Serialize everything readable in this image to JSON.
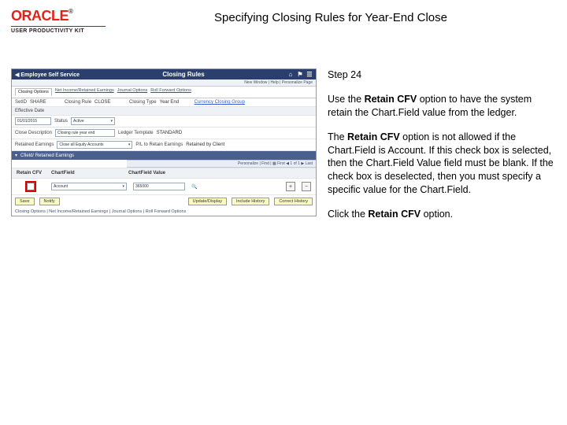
{
  "header": {
    "brand": "ORACLE",
    "suite": "USER PRODUCTIVITY KIT",
    "title": "Specifying Closing Rules for Year-End Close"
  },
  "instructions": {
    "step_label": "Step 24",
    "p1a": "Use the ",
    "p1b": "Retain CFV",
    "p1c": " option to have the system retain the Chart.Field value from the ledger.",
    "p2a": "The ",
    "p2b": "Retain CFV",
    "p2c": " option is not allowed if the Chart.Field is Account. If this check box is selected, then the Chart.Field Value field must be blank. If the check box is deselected, then you must specify a specific value for the Chart.Field.",
    "p3a": "Click the ",
    "p3b": "Retain CFV",
    "p3c": " option."
  },
  "app": {
    "back": "Employee Self Service",
    "page_title": "Closing Rules",
    "icons": {
      "home": "⌂",
      "flag": "⚑",
      "menu": "☰"
    },
    "sublinks": "New Window | Help | Personalize Page",
    "tabs": [
      "Closing Options",
      "Net Income/Retained Earnings",
      "Journal Options",
      "Roll Forward Options"
    ],
    "active_tab": 0,
    "fields": {
      "setid_label": "SetID",
      "setid_value": "SHARE",
      "rule_label": "Closing Rule",
      "rule_value": "CLOSE",
      "type_label": "Closing Type",
      "type_value": "Year End",
      "group_label": "Currency Closing Group",
      "eff_label": "Effective Date",
      "eff_value": "01/01/2015",
      "status_label": "Status",
      "status_value": "Active",
      "desc_label": "Close Description",
      "desc_value": "Closing rule year end",
      "ledger_label": "Ledger Template",
      "ledger_value": "STANDARD",
      "scope_label": "Retained Earnings",
      "scope_value": "Close all Equity Accounts",
      "pl_label": "P/L to Retain Earnings",
      "pl_value": "Retained by Client"
    },
    "section_title": "Cfield/ Retained Earnings",
    "grid": {
      "toolbar": "Personalize | Find | ▦   First ◀ 1 of 1 ▶ Last",
      "col_retain": "Retain CFV",
      "col_cf": "ChartField",
      "col_val": "ChartField Value",
      "cf_value": "Account",
      "val_value": "365000"
    },
    "buttons": {
      "save": "Save",
      "notify": "Notify",
      "update": "Update/Display",
      "history": "Include History",
      "correct": "Correct History"
    },
    "footer": "Closing Options | Net Income/Retained Earnings | Journal Options | Roll Forward Options"
  }
}
